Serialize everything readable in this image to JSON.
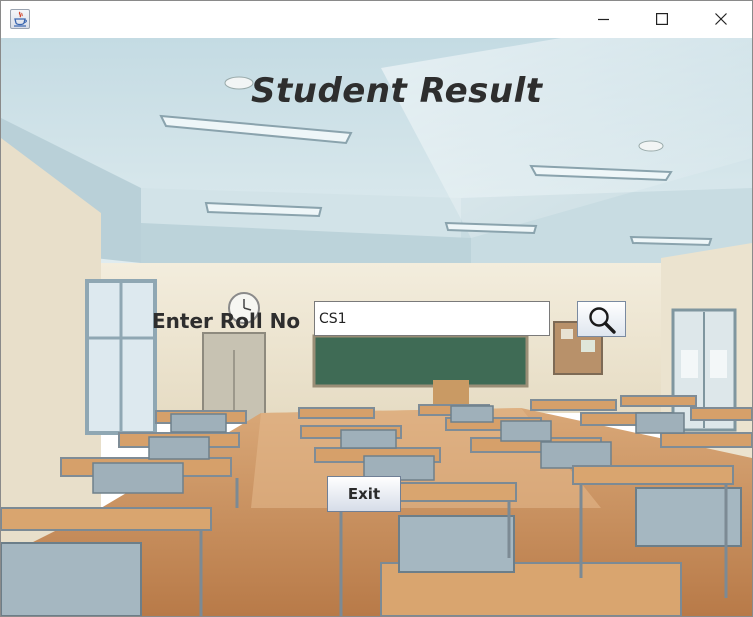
{
  "window": {
    "app_icon": "java-cup-icon",
    "controls": [
      "minimize-icon",
      "maximize-icon",
      "close-icon"
    ]
  },
  "main": {
    "title": "Student Result",
    "roll_label": "Enter Roll No",
    "roll_input_value": "CS1",
    "search_icon": "search-icon",
    "exit_label": "Exit"
  },
  "colors": {
    "title_text": "#2e2e2e",
    "wall": "#efe8d6",
    "ceiling": "#cfe0e6",
    "floor": "#c98c5a",
    "chalkboard": "#3f6b55"
  }
}
